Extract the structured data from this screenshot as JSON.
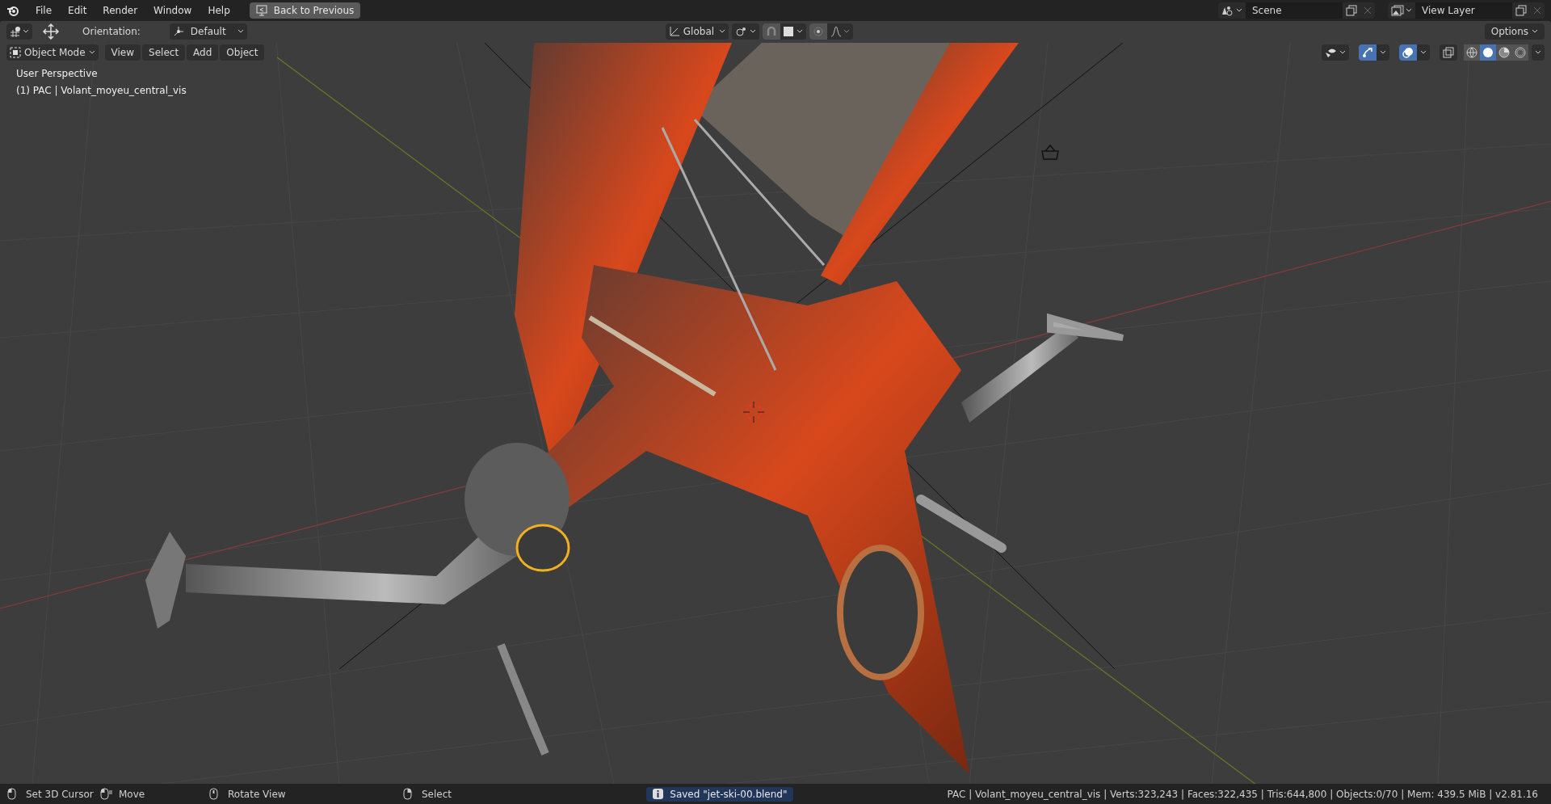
{
  "menu_bar": {
    "menus": [
      "File",
      "Edit",
      "Render",
      "Window",
      "Help"
    ],
    "back_button": "Back to Previous"
  },
  "scene": {
    "name": "Scene"
  },
  "view_layer": {
    "name": "View Layer"
  },
  "tool_header": {
    "orientation_label": "Orientation:",
    "orientation": "Default",
    "transform_orientation": "Global",
    "options": "Options"
  },
  "viewport_header": {
    "mode": "Object Mode",
    "menus": [
      "View",
      "Select",
      "Add",
      "Object"
    ],
    "gizmos_on": true,
    "overlays_on": true,
    "shading": [
      {
        "kind": "wireframe",
        "selected": false
      },
      {
        "kind": "solid",
        "selected": true
      },
      {
        "kind": "material",
        "selected": false
      },
      {
        "kind": "rendered",
        "selected": false
      }
    ]
  },
  "viewport_text": [
    "User Perspective",
    "(1) PAC | Volant_moyeu_central_vis"
  ],
  "status_bar": {
    "hints": [
      {
        "kind": "left",
        "label": "Set 3D Cursor"
      },
      {
        "kind": "drag",
        "label": "Move"
      },
      {
        "kind": "middle",
        "label": "Rotate View"
      },
      {
        "kind": "right",
        "label": "Select"
      }
    ],
    "report": "Saved \"jet-ski-00.blend\"",
    "stats": "PAC | Volant_moyeu_central_vis | Verts:323,243 | Faces:322,435 | Tris:644,800 | Objects:0/70 | Mem: 439.5 MiB | v2.81.16"
  }
}
